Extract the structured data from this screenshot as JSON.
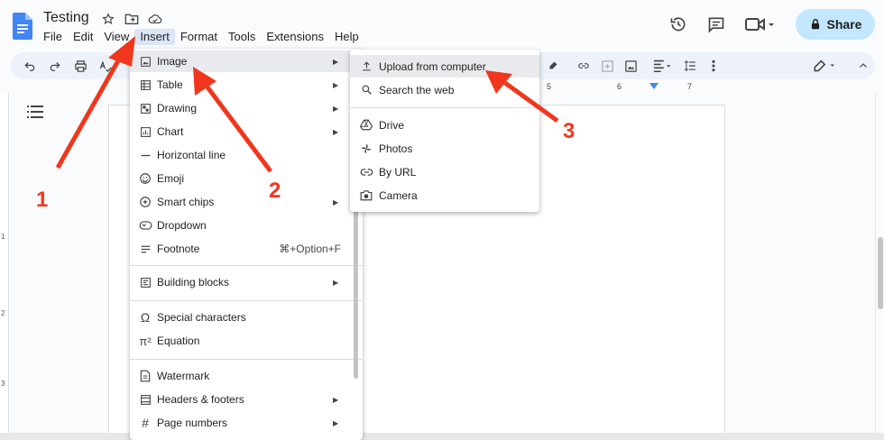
{
  "window": {
    "doc_title": "Testing"
  },
  "menubar": {
    "items": [
      "File",
      "Edit",
      "View",
      "Insert",
      "Format",
      "Tools",
      "Extensions",
      "Help"
    ],
    "active": "Insert"
  },
  "header": {
    "share_label": "Share"
  },
  "ruler": {
    "numbers": [
      "5",
      "6",
      "7"
    ]
  },
  "vruler": {
    "numbers": [
      "1",
      "2",
      "3"
    ]
  },
  "insert_menu": {
    "items": [
      {
        "label": "Image",
        "icon": "image-icon",
        "submenu": true,
        "highlighted": true
      },
      {
        "label": "Table",
        "icon": "table-icon",
        "submenu": true
      },
      {
        "label": "Drawing",
        "icon": "drawing-icon",
        "submenu": true
      },
      {
        "label": "Chart",
        "icon": "chart-icon",
        "submenu": true
      },
      {
        "label": "Horizontal line",
        "icon": "horizontal-line-icon"
      },
      {
        "label": "Emoji",
        "icon": "emoji-icon"
      },
      {
        "label": "Smart chips",
        "icon": "smart-chips-icon",
        "submenu": true
      },
      {
        "label": "Dropdown",
        "icon": "dropdown-icon"
      },
      {
        "label": "Footnote",
        "icon": "footnote-icon",
        "shortcut": "⌘+Option+F"
      },
      {
        "label": "Building blocks",
        "icon": "building-blocks-icon",
        "submenu": true
      },
      {
        "label": "Special characters",
        "icon": "omega-icon"
      },
      {
        "label": "Equation",
        "icon": "pi-icon"
      },
      {
        "label": "Watermark",
        "icon": "watermark-icon"
      },
      {
        "label": "Headers & footers",
        "icon": "headers-footers-icon",
        "submenu": true
      },
      {
        "label": "Page numbers",
        "icon": "hash-icon",
        "submenu": true
      }
    ]
  },
  "image_submenu": {
    "items": [
      {
        "label": "Upload from computer",
        "icon": "upload-icon",
        "highlighted": true
      },
      {
        "label": "Search the web",
        "icon": "search-icon"
      },
      {
        "label": "Drive",
        "icon": "drive-icon"
      },
      {
        "label": "Photos",
        "icon": "photos-icon"
      },
      {
        "label": "By URL",
        "icon": "link-icon"
      },
      {
        "label": "Camera",
        "icon": "camera-icon"
      }
    ]
  },
  "annotations": {
    "steps": [
      "1",
      "2",
      "3"
    ],
    "color": "#f0371d"
  },
  "colors": {
    "share_bg": "#c2e7ff",
    "toolbar_bg": "#edf2fa",
    "doc_blue": "#4285f4"
  }
}
